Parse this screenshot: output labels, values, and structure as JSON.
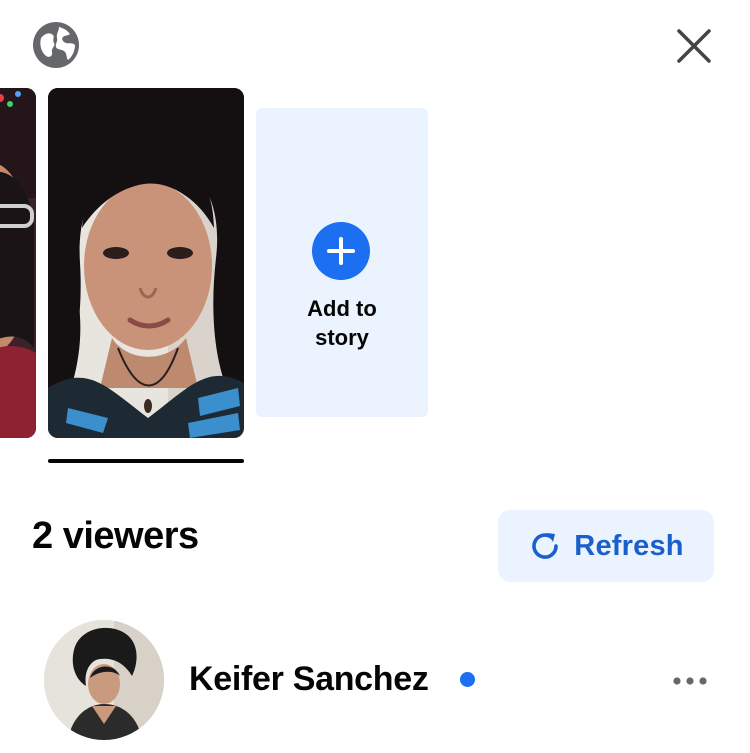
{
  "header": {
    "privacy_icon": "globe-icon",
    "close_icon": "close-icon"
  },
  "stories": {
    "add_card": {
      "icon": "plus-icon",
      "label": "Add to\nstory"
    }
  },
  "viewers": {
    "title": "2 viewers",
    "refresh": {
      "icon": "refresh-icon",
      "label": "Refresh"
    },
    "list": [
      {
        "name": "Keifer Sanchez",
        "online": true,
        "more_icon": "more-horizontal-icon"
      }
    ]
  },
  "colors": {
    "accent": "#1b6ff0",
    "accent_text": "#1b5fcc",
    "tint_background": "#ebf3fe",
    "icon_gray": "#65676b"
  }
}
